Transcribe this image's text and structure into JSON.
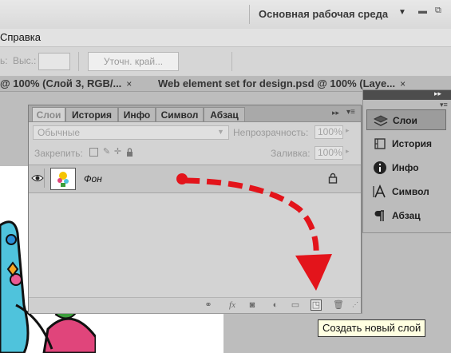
{
  "app": {
    "workspace_label": "Основная рабочая среда"
  },
  "menu": {
    "help": "Справка"
  },
  "options_bar": {
    "style_fragment": "ь:",
    "height_label": "Выс.:",
    "refine_edge": "Уточн. край..."
  },
  "doc_tabs": [
    {
      "label": "@ 100% (Слой 3, RGB/...",
      "close": "×"
    },
    {
      "label": "Web element set for design.psd @ 100% (Laye...",
      "close": "×"
    }
  ],
  "layers_panel": {
    "tabs": [
      {
        "label": "Слои",
        "active": true
      },
      {
        "label": "История",
        "active": false
      },
      {
        "label": "Инфо",
        "active": false
      },
      {
        "label": "Символ",
        "active": false
      },
      {
        "label": "Абзац",
        "active": false
      }
    ],
    "blend_mode": "Обычные",
    "opacity_label": "Непрозрачность:",
    "opacity_value": "100%",
    "lock_label": "Закрепить:",
    "fill_label": "Заливка:",
    "fill_value": "100%",
    "layers": [
      {
        "name": "Фон",
        "visible": true,
        "locked": true
      }
    ]
  },
  "dock": {
    "items": [
      {
        "label": "Слои",
        "icon": "layers-icon",
        "active": true
      },
      {
        "label": "История",
        "icon": "history-icon",
        "active": false
      },
      {
        "label": "Инфо",
        "icon": "info-icon",
        "active": false
      },
      {
        "label": "Символ",
        "icon": "character-icon",
        "active": false
      },
      {
        "label": "Абзац",
        "icon": "paragraph-icon",
        "active": false
      }
    ]
  },
  "tooltip": {
    "text": "Создать новый слой"
  },
  "colors": {
    "annotation_arrow": "#e3141b",
    "tooltip_bg": "#ffffe1"
  }
}
